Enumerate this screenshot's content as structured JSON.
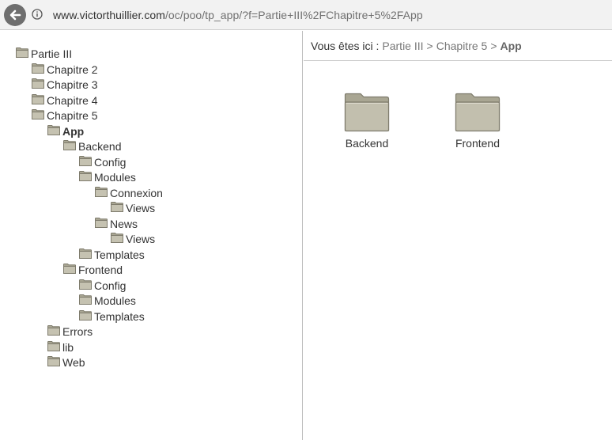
{
  "browser": {
    "url_host": "www.victorthuillier.com",
    "url_path": "/oc/poo/tp_app/?f=Partie+III%2FChapitre+5%2FApp"
  },
  "tree": {
    "n0": "Partie III",
    "n1": "Chapitre 2",
    "n2": "Chapitre 3",
    "n3": "Chapitre 4",
    "n4": "Chapitre 5",
    "n5": "App",
    "n6": "Backend",
    "n7": "Config",
    "n8": "Modules",
    "n9": "Connexion",
    "n10": "Views",
    "n11": "News",
    "n12": "Views",
    "n13": "Templates",
    "n14": "Frontend",
    "n15": "Config",
    "n16": "Modules",
    "n17": "Templates",
    "n18": "Errors",
    "n19": "lib",
    "n20": "Web"
  },
  "breadcrumb": {
    "prefix": "Vous êtes ici :",
    "link1": "Partie III",
    "link2": "Chapitre 5",
    "current": "App",
    "separator": ">"
  },
  "content": {
    "folder1": "Backend",
    "folder2": "Frontend"
  },
  "colors": {
    "folder_body": "#b8b5a3",
    "folder_edge": "#7e7b6c"
  }
}
